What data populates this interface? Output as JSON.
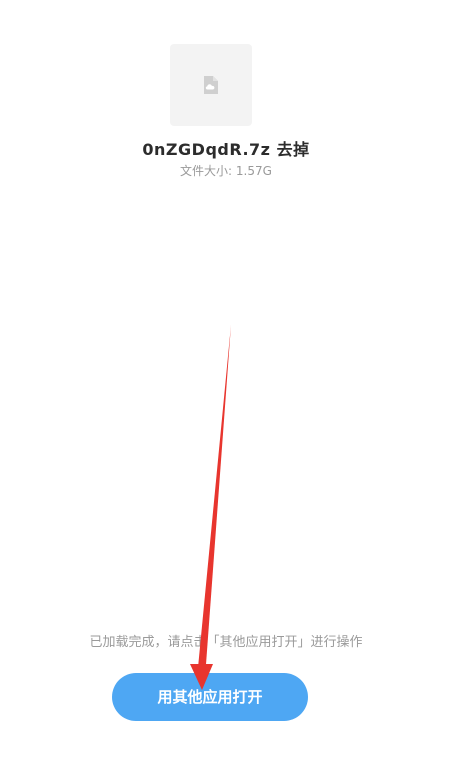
{
  "file": {
    "icon": "cloud-file-icon",
    "name": "0nZGDqdR.7z 去掉",
    "size_text": "文件大小: 1.57G"
  },
  "status": {
    "hint": "已加载完成，请点击「其他应用打开」进行操作"
  },
  "actions": {
    "open_with_other_app_label": "用其他应用打开"
  },
  "colors": {
    "button": "#4ea7f3",
    "arrow": "#e8352e",
    "thumb_bg": "#f3f3f3",
    "hint_text": "#9a9a9a"
  }
}
